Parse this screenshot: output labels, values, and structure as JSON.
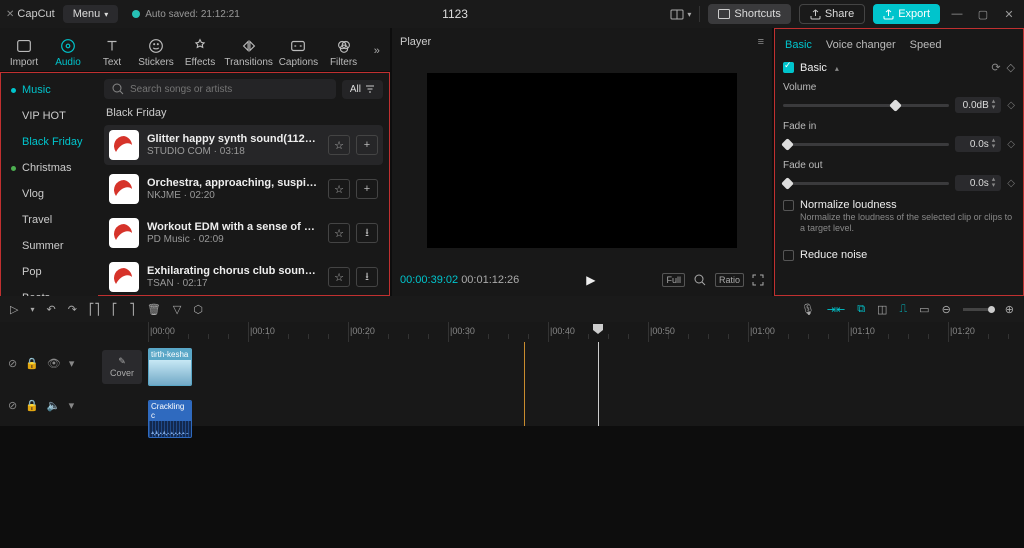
{
  "title": {
    "app": "CapCut",
    "menu": "Menu",
    "autosave": "Auto saved: 21:12:21",
    "project": "1123"
  },
  "toolbar": {
    "shortcuts": "Shortcuts",
    "share": "Share",
    "export": "Export"
  },
  "tabs": [
    "Import",
    "Audio",
    "Text",
    "Stickers",
    "Effects",
    "Transitions",
    "Captions",
    "Filters"
  ],
  "cats": [
    "Music",
    "VIP HOT",
    "Black Friday",
    "Christmas",
    "Vlog",
    "Travel",
    "Summer",
    "Pop",
    "Beats"
  ],
  "search": {
    "placeholder": "Search songs or artists",
    "all": "All"
  },
  "section": "Black Friday",
  "tracks": [
    {
      "title": "Glitter happy synth sound(112170)",
      "artist": "STUDIO COM",
      "dur": "03:18"
    },
    {
      "title": "Orchestra, approaching, suspicious, esca...",
      "artist": "NKJME",
      "dur": "02:20"
    },
    {
      "title": "Workout EDM with a sense of speed(101...",
      "artist": "PD Music",
      "dur": "02:09"
    },
    {
      "title": "Exhilarating chorus club sound CM imag...",
      "artist": "TSAN",
      "dur": "02:17"
    }
  ],
  "player": {
    "label": "Player",
    "cur": "00:00:39:02",
    "total": "00:01:12:26",
    "full": "Full",
    "ratio": "Ratio"
  },
  "props": {
    "tabs": [
      "Basic",
      "Voice changer",
      "Speed"
    ],
    "block": "Basic",
    "volume": {
      "label": "Volume",
      "val": "0.0dB"
    },
    "fadein": {
      "label": "Fade in",
      "val": "0.0s"
    },
    "fadeout": {
      "label": "Fade out",
      "val": "0.0s"
    },
    "normalize": {
      "title": "Normalize loudness",
      "desc": "Normalize the loudness of the selected clip or clips to a target level."
    },
    "reduce": {
      "title": "Reduce noise"
    }
  },
  "ruler": [
    "|00:00",
    "|00:10",
    "|00:20",
    "|00:30",
    "|00:40",
    "|00:50",
    "|01:00",
    "|01:10",
    "|01:20"
  ],
  "clips": {
    "video": "tirth-kesha",
    "audio": "Crackling c",
    "cover": "Cover"
  }
}
